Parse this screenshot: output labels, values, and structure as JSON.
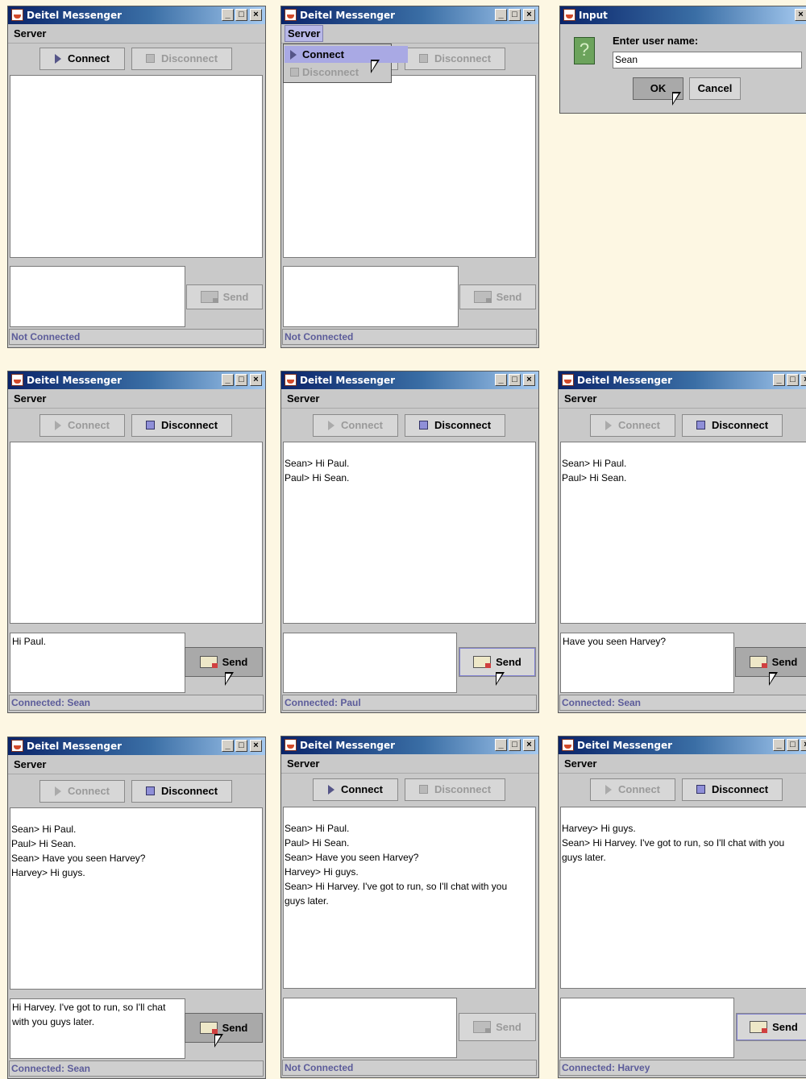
{
  "app_title": "Deitel Messenger",
  "menu_label": "Server",
  "connect_label": "Connect",
  "disconnect_label": "Disconnect",
  "send_label": "Send",
  "dialog": {
    "title": "Input",
    "prompt": "Enter user name:",
    "value": "Sean",
    "ok_label": "OK",
    "cancel_label": "Cancel"
  },
  "windows": [
    {
      "chat": "",
      "input": "",
      "status": "Not Connected"
    },
    {
      "chat": "",
      "input": "",
      "status": "Not Connected"
    },
    {
      "chat": "",
      "input": "Hi Paul.",
      "status": "Connected: Sean"
    },
    {
      "chat": "Sean> Hi Paul.\nPaul> Hi Sean.",
      "input": "",
      "status": "Connected: Paul"
    },
    {
      "chat": "Sean> Hi Paul.\nPaul> Hi Sean.",
      "input": "Have you seen Harvey?",
      "status": "Connected: Sean"
    },
    {
      "chat": "Sean> Hi Paul.\nPaul> Hi Sean.\nSean> Have you seen Harvey?\nHarvey> Hi guys.",
      "input": "Hi Harvey. I've got to run, so I'll chat\nwith you guys later.",
      "status": "Connected: Sean"
    },
    {
      "chat": "Sean> Hi Paul.\nPaul> Hi Sean.\nSean> Have you seen Harvey?\nHarvey> Hi guys.\nSean> Hi Harvey. I've got to run, so I'll chat with you\nguys later.",
      "input": "",
      "status": "Not Connected"
    },
    {
      "chat": "Harvey> Hi guys.\nSean> Hi Harvey. I've got to run, so I'll chat with you\nguys later.",
      "input": "",
      "status": "Connected: Harvey"
    }
  ]
}
